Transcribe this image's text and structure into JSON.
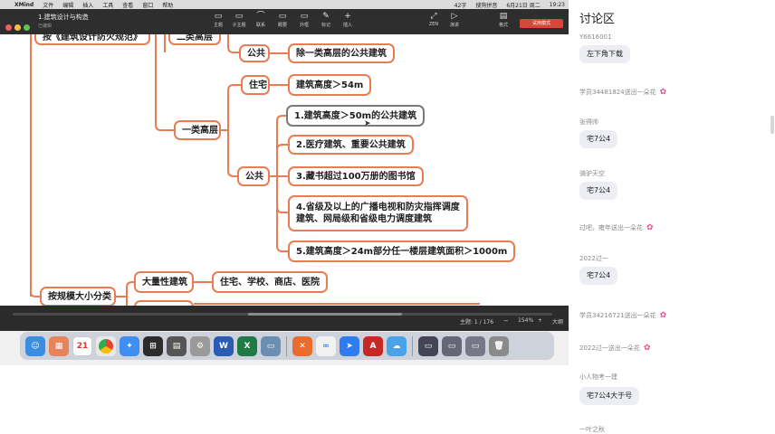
{
  "menubar": {
    "app": "XMind",
    "items": [
      "文件",
      "编辑",
      "插入",
      "工具",
      "查看",
      "窗口",
      "帮助"
    ],
    "right": [
      "42字",
      "搜狗拼音",
      "6月21日 周二",
      "19:23"
    ]
  },
  "window": {
    "title": "1.建筑设计与构造",
    "subtitle": "已编辑",
    "tools": [
      {
        "icon": "▭",
        "label": "主题"
      },
      {
        "icon": "▭",
        "label": "子主题"
      },
      {
        "icon": "⌒",
        "label": "联系"
      },
      {
        "icon": "▭",
        "label": "概要"
      },
      {
        "icon": "▭",
        "label": "外框"
      },
      {
        "icon": "✎",
        "label": "标记"
      },
      {
        "icon": "+",
        "label": "插入"
      }
    ],
    "right_tools": [
      {
        "icon": "⤢",
        "label": "ZEN"
      },
      {
        "icon": "▷",
        "label": "演讲"
      },
      {
        "icon": "▤",
        "label": "格式"
      }
    ],
    "trial_button": "试用模式"
  },
  "mindmap": {
    "top_left": "按《建筑设计防火规范》",
    "top_mid": "二类高层",
    "gonggong_top": "公共",
    "gonggong_top_desc": "除一类高层的公共建筑",
    "class1": "一类高层",
    "zhuzhai": "住宅",
    "zhuzhai_desc": "建筑高度＞54m",
    "gonggong": "公共",
    "items": [
      "1.建筑高度＞50m的公共建筑",
      "2.医疗建筑、重要公共建筑",
      "3.藏书超过100万册的图书馆",
      "4.省级及以上的广播电视和防灾指挥调度",
      "建筑、网局级和省级电力调度建筑",
      "5.建筑高度＞24m部分任一楼层建筑面积＞1000m"
    ],
    "by_scale": "按规模大小分类",
    "mass": "大量性建筑",
    "mass_desc": "住宅、学校、商店、医院"
  },
  "statusbar": {
    "topic": "主题: 1 / 176",
    "zoom": "154%",
    "outline": "大纲"
  },
  "dock": {
    "calendar_day": "21",
    "word": "W",
    "excel": "X"
  },
  "panel": {
    "title": "讨论区",
    "messages": [
      {
        "type": "name",
        "text": "Y6616001"
      },
      {
        "type": "bubble",
        "text": "左下角下载"
      },
      {
        "type": "gift",
        "text": "学员34481824送出一朵花"
      },
      {
        "type": "name",
        "text": "张得帅"
      },
      {
        "type": "bubble",
        "text": "宅7公4"
      },
      {
        "type": "name",
        "text": "骑驴天空"
      },
      {
        "type": "bubble",
        "text": "宅7公4"
      },
      {
        "type": "gift",
        "text": "过吧，雍年送出一朵花"
      },
      {
        "type": "name",
        "text": "2022过一"
      },
      {
        "type": "bubble",
        "text": "宅7公4"
      },
      {
        "type": "gift",
        "text": "学员34216721送出一朵花"
      },
      {
        "type": "gift",
        "text": "2022过一送出一朵花"
      },
      {
        "type": "name",
        "text": "小人物考一建"
      },
      {
        "type": "bubble",
        "text": "宅7公4大于号"
      },
      {
        "type": "name",
        "text": "一叶之秋"
      }
    ]
  }
}
